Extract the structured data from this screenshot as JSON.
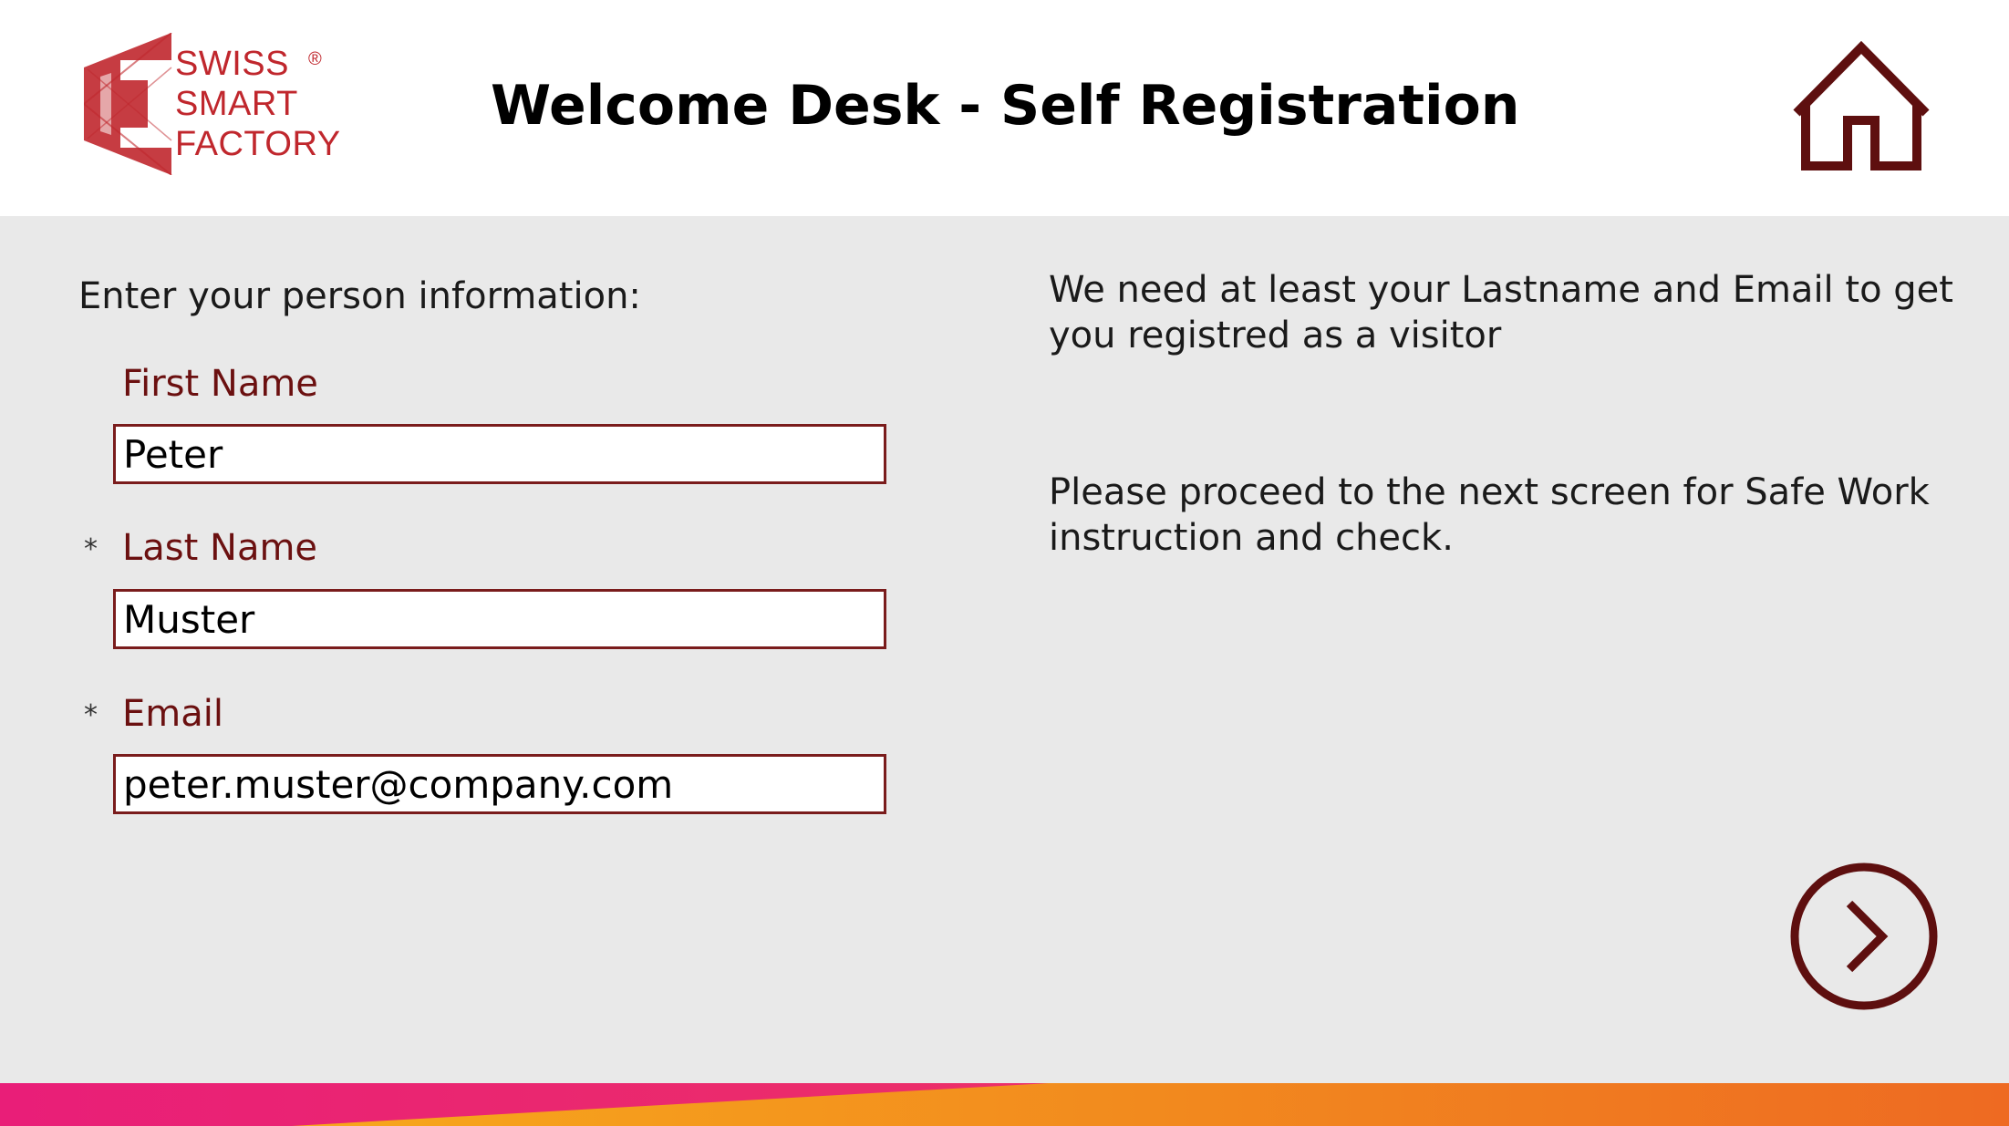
{
  "header": {
    "logo": {
      "line1": "SWISS",
      "line2": "SMART",
      "line3": "FACTORY",
      "registered_mark": "®",
      "brand_color": "#c0272d"
    },
    "title": "Welcome Desk - Self Registration",
    "home_icon": "home-icon"
  },
  "form": {
    "intro": "Enter your person information:",
    "required_marker": "*",
    "fields": [
      {
        "label": "First Name",
        "value": "Peter",
        "required": false
      },
      {
        "label": "Last Name",
        "value": "Muster",
        "required": true
      },
      {
        "label": "Email",
        "value": "peter.muster@company.com",
        "required": true
      }
    ]
  },
  "info": {
    "requirement_text": "We need at least your Lastname and Email to get you registred as a visitor",
    "proceed_text": "Please proceed to the next screen for Safe Work instruction and check."
  },
  "navigation": {
    "next_icon": "chevron-right-icon"
  },
  "colors": {
    "accent": "#6b1010",
    "background": "#e9e9e9",
    "footer_pink": "#e91e78",
    "footer_orange": "#f39c1b"
  }
}
